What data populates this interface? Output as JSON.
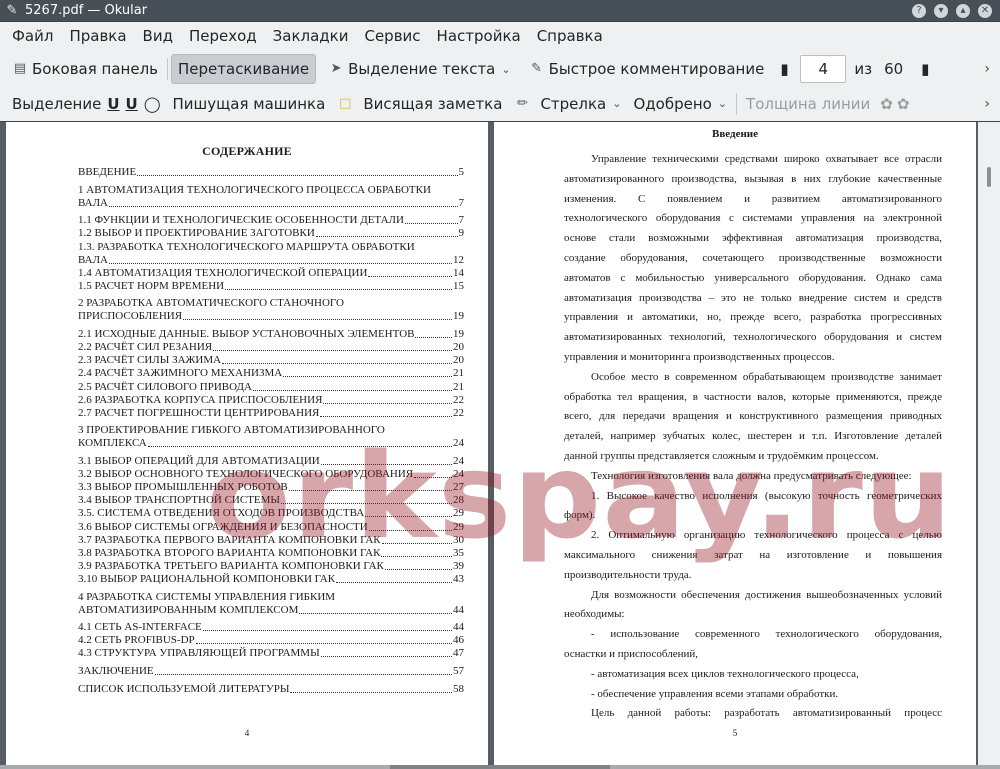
{
  "window": {
    "title": "5267.pdf  — Okular"
  },
  "menu": [
    "Файл",
    "Правка",
    "Вид",
    "Переход",
    "Закладки",
    "Сервис",
    "Настройка",
    "Справка"
  ],
  "toolbar1": {
    "sidebar_label": "Боковая панель",
    "drag_label": "Перетаскивание",
    "text_select_label": "Выделение текста",
    "quick_comment_label": "Быстрое комментирование",
    "page_current": "4",
    "page_of": "из",
    "page_total": "60"
  },
  "toolbar2": {
    "selection_label": "Выделение",
    "typewriter_label": "Пишущая машинка",
    "sticky_note_label": "Висящая заметка",
    "arrow_label": "Стрелка",
    "stamp_label": "Одобрено",
    "line_width_label": "Толщина линии"
  },
  "left_page": {
    "heading": "СОДЕРЖАНИЕ",
    "entries": [
      {
        "text": "ВВЕДЕНИЕ",
        "page": "5"
      },
      {
        "first": "1 АВТОМАТИЗАЦИЯ ТЕХНОЛОГИЧЕСКОГО ПРОЦЕССА ОБРАБОТКИ",
        "text": "ВАЛА",
        "page": "7"
      },
      {
        "text": "1.1 ФУНКЦИИ И ТЕХНОЛОГИЧЕСКИЕ ОСОБЕННОСТИ ДЕТАЛИ",
        "page": "7"
      },
      {
        "text": "1.2 ВЫБОР И ПРОЕКТИРОВАНИЕ ЗАГОТОВКИ",
        "page": "9"
      },
      {
        "first": "1.3. РАЗРАБОТКА ТЕХНОЛОГИЧЕСКОГО МАРШРУТА ОБРАБОТКИ",
        "text": "ВАЛА",
        "page": "12"
      },
      {
        "text": "1.4 АВТОМАТИЗАЦИЯ ТЕХНОЛОГИЧЕСКОЙ ОПЕРАЦИИ",
        "page": "14"
      },
      {
        "text": "1.5 РАСЧЕТ НОРМ ВРЕМЕНИ",
        "page": "15"
      },
      {
        "first": "2 РАЗРАБОТКА АВТОМАТИЧЕСКОГО СТАНОЧНОГО",
        "text": "ПРИСПОСОБЛЕНИЯ",
        "page": "19"
      },
      {
        "text": "2.1 ИСХОДНЫЕ ДАННЫЕ. ВЫБОР УСТАНОВОЧНЫХ ЭЛЕМЕНТОВ",
        "page": "19"
      },
      {
        "text": "2.2 РАСЧЁТ СИЛ РЕЗАНИЯ",
        "page": "20"
      },
      {
        "text": "2.3 РАСЧЁТ СИЛЫ ЗАЖИМА",
        "page": "20"
      },
      {
        "text": "2.4 РАСЧЁТ ЗАЖИМНОГО МЕХАНИЗМА",
        "page": "21"
      },
      {
        "text": "2.5 РАСЧЁТ СИЛОВОГО ПРИВОДА",
        "page": "21"
      },
      {
        "text": "2.6 РАЗРАБОТКА КОРПУСА ПРИСПОСОБЛЕНИЯ",
        "page": "22"
      },
      {
        "text": "2.7 РАСЧЕТ ПОГРЕШНОСТИ ЦЕНТРИРОВАНИЯ",
        "page": "22"
      },
      {
        "first": "3 ПРОЕКТИРОВАНИЕ ГИБКОГО АВТОМАТИЗИРОВАННОГО",
        "text": "КОМПЛЕКСА",
        "page": "24"
      },
      {
        "text": "3.1 ВЫБОР ОПЕРАЦИЙ ДЛЯ АВТОМАТИЗАЦИИ",
        "page": "24"
      },
      {
        "text": "3.2 ВЫБОР ОСНОВНОГО ТЕХНОЛОГИЧЕСКОГО ОБОРУДОВАНИЯ",
        "page": "24"
      },
      {
        "text": "3.3 ВЫБОР ПРОМЫШЛЕННЫХ РОБОТОВ",
        "page": "27"
      },
      {
        "text": "3.4 ВЫБОР ТРАНСПОРТНОЙ СИСТЕМЫ",
        "page": "28"
      },
      {
        "text": "3.5. СИСТЕМА ОТВЕДЕНИЯ ОТХОДОВ ПРОИЗВОДСТВА",
        "page": "29"
      },
      {
        "text": "3.6 ВЫБОР СИСТЕМЫ ОГРАЖДЕНИЯ И БЕЗОПАСНОСТИ",
        "page": "29"
      },
      {
        "text": "3.7 РАЗРАБОТКА ПЕРВОГО ВАРИАНТА КОМПОНОВКИ ГАК",
        "page": "30"
      },
      {
        "text": "3.8 РАЗРАБОТКА ВТОРОГО ВАРИАНТА КОМПОНОВКИ ГАК",
        "page": "35"
      },
      {
        "text": "3.9 РАЗРАБОТКА ТРЕТЬЕГО ВАРИАНТА КОМПОНОВКИ ГАК",
        "page": "39"
      },
      {
        "text": "3.10 ВЫБОР РАЦИОНАЛЬНОЙ КОМПОНОВКИ ГАК",
        "page": "43"
      },
      {
        "first": "4 РАЗРАБОТКА СИСТЕМЫ УПРАВЛЕНИЯ ГИБКИМ",
        "text": "АВТОМАТИЗИРОВАННЫМ КОМПЛЕКСОМ",
        "page": "44"
      },
      {
        "text": "4.1 СЕТЬ AS-INTERFACE",
        "page": "44"
      },
      {
        "text": "4.2 СЕТЬ PROFIBUS-DP",
        "page": "46"
      },
      {
        "text": "4.3 СТРУКТУРА УПРАВЛЯЮЩЕЙ ПРОГРАММЫ",
        "page": "47"
      },
      {
        "text": "ЗАКЛЮЧЕНИЕ",
        "page": "57"
      },
      {
        "text": "СПИСОК ИСПОЛЬЗУЕМОЙ ЛИТЕРАТУРЫ",
        "page": "58"
      }
    ],
    "page_number": "4"
  },
  "right_page": {
    "heading": "Введение",
    "lines": [
      "Управление техническими средствами широко охватывает все отрасли",
      "автоматизированного производства, вызывая в них глубокие качественные",
      "изменения. С появлением и развитием автоматизированного",
      "технологического оборудования с системами управления на электронной",
      "основе стали возможными эффективная автоматизация производства,",
      "создание оборудования, сочетающего производственные возможности",
      "автоматов с мобильностью универсального оборудования. Однако сама",
      "автоматизация производства – это не только внедрение систем и средств",
      "управления и автоматики, но, прежде всего, разработка прогрессивных",
      "автоматизированных технологий, технологического оборудования и систем",
      "управления и мониторинга производственных процессов.",
      "Особое место в современном обрабатывающем производстве занимает",
      "обработка тел вращения, в частности валов, которые применяются, прежде",
      "всего, для передачи вращения и конструктивного размещения приводных",
      "деталей, например зубчатых колес, шестерен и т.п. Изготовление деталей",
      "данной группы представляется сложным и трудоёмким процессом.",
      "Технология изготовления вала должна предусматривать следующее:",
      "1. Высокое качество исполнения (высокую точность геометрических",
      "форм).",
      "2. Оптимальную организацию технологического процесса с целью",
      "максимального снижения затрат на изготовление и повышения",
      "производительности труда.",
      "Для возможности обеспечения достижения вышеобозначенных условий",
      "необходимы:",
      "- использование современного технологического оборудования,",
      "оснастки и приспособлений,",
      "- автоматизация всех циклов технологического процесса,",
      "- обеспечение управления всеми этапами обработки.",
      "Цель данной работы: разработать автоматизированный процесс"
    ],
    "page_number": "5"
  },
  "watermark": "orkspay.ru"
}
